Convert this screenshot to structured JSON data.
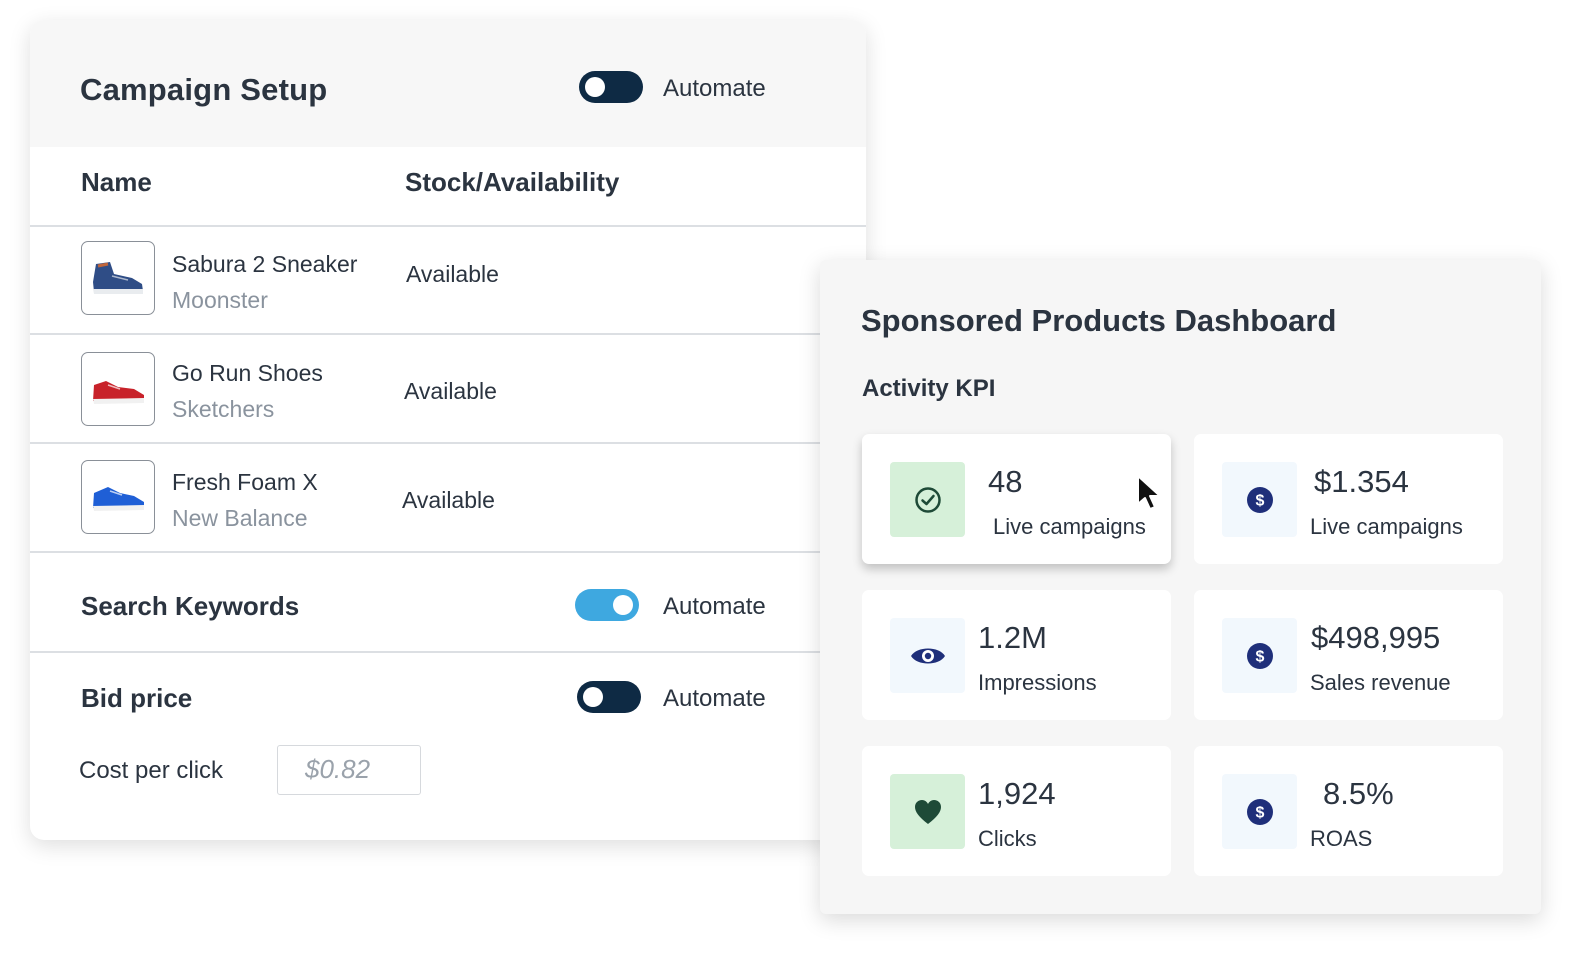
{
  "campaign_setup": {
    "title": "Campaign Setup",
    "automate_label": "Automate",
    "automate_on": false,
    "columns": {
      "name": "Name",
      "stock": "Stock/Availability"
    },
    "products": [
      {
        "name": "Sabura 2 Sneaker",
        "brand": "Moonster",
        "stock": "Available",
        "shoe_color": "#2f4d86"
      },
      {
        "name": "Go Run Shoes",
        "brand": "Sketchers",
        "stock": "Available",
        "shoe_color": "#c8222a"
      },
      {
        "name": "Fresh Foam X",
        "brand": "New Balance",
        "stock": "Available",
        "shoe_color": "#1f5fd6"
      }
    ],
    "search_keywords": {
      "title": "Search Keywords",
      "automate_label": "Automate",
      "automate_on": true
    },
    "bid_price": {
      "title": "Bid price",
      "automate_label": "Automate",
      "automate_on": false,
      "cpc_label": "Cost per click",
      "cpc_placeholder": "$0.82"
    }
  },
  "dashboard": {
    "title": "Sponsored Products Dashboard",
    "section": "Activity KPI",
    "kpis": [
      {
        "value": "48",
        "label": "Live campaigns",
        "icon": "check-circle-icon"
      },
      {
        "value": "$1.354",
        "label": "Live campaigns",
        "icon": "dollar-icon"
      },
      {
        "value": "1.2M",
        "label": "Impressions",
        "icon": "eye-icon"
      },
      {
        "value": "$498,995",
        "label": "Sales revenue",
        "icon": "dollar-icon"
      },
      {
        "value": "1,924",
        "label": "Clicks",
        "icon": "heart-icon"
      },
      {
        "value": "8.5%",
        "label": "ROAS",
        "icon": "dollar-icon"
      }
    ]
  },
  "colors": {
    "toggle_off": "#0e2a44",
    "toggle_on": "#3ea8e0",
    "icon_green_bg": "#d6f0d9",
    "icon_navy": "#1f2f7a",
    "text": "#2b3440",
    "muted": "#8a939e"
  }
}
